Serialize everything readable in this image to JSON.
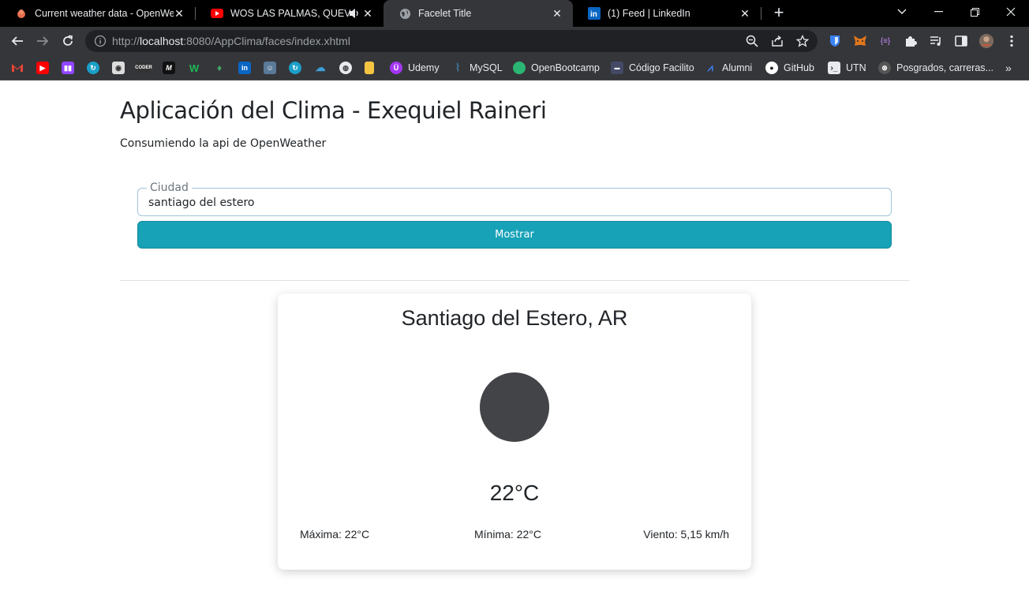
{
  "browser": {
    "tabs": [
      {
        "title": "Current weather data - OpenWea",
        "icon": "openweather-icon"
      },
      {
        "title": "WOS LAS PALMAS, QUEVEDO",
        "icon": "youtube-icon",
        "audio": true
      },
      {
        "title": "Facelet Title",
        "icon": "globe-icon",
        "active": true
      },
      {
        "title": "(1) Feed | LinkedIn",
        "icon": "linkedin-icon"
      }
    ],
    "url_scheme": "http://",
    "url_host": "localhost",
    "url_rest": ":8080/AppClima/faces/index.xhtml",
    "bookmarks": [
      {
        "label": "",
        "icon": "gmail-icon",
        "color": "#ea4335"
      },
      {
        "label": "",
        "icon": "youtube-icon",
        "color": "#ff0000"
      },
      {
        "label": "",
        "icon": "twitch-icon",
        "color": "#9146ff"
      },
      {
        "label": "",
        "icon": "refresh-circle-icon",
        "color": "#1a73e8"
      },
      {
        "label": "",
        "icon": "camera-icon",
        "color": "#888888"
      },
      {
        "label": "",
        "icon": "coder-icon",
        "color": "#444444"
      },
      {
        "label": "",
        "icon": "medium-icon",
        "color": "#111111"
      },
      {
        "label": "",
        "icon": "w-icon",
        "color": "#1db954"
      },
      {
        "label": "",
        "icon": "ethereum-icon",
        "color": "#3fa66b"
      },
      {
        "label": "",
        "icon": "linkedin-icon",
        "color": "#0a66c2"
      },
      {
        "label": "",
        "icon": "avatar-icon",
        "color": "#5a7a99"
      },
      {
        "label": "",
        "icon": "refresh-circle-icon",
        "color": "#1a73e8"
      },
      {
        "label": "",
        "icon": "cloud-icon",
        "color": "#3b9fd8"
      },
      {
        "label": "",
        "icon": "globe-icon",
        "color": "#cccccc"
      },
      {
        "label": "",
        "icon": "note-icon",
        "color": "#f5c542"
      },
      {
        "label": "Udemy",
        "icon": "udemy-icon",
        "color": "#a435f0"
      },
      {
        "label": "MySQL",
        "icon": "mysql-icon",
        "color": "#4479a1"
      },
      {
        "label": "OpenBootcamp",
        "icon": "openbootcamp-icon",
        "color": "#2bb673"
      },
      {
        "label": "Código Facilito",
        "icon": "codigofacilito-icon",
        "color": "#5c6bc0"
      },
      {
        "label": "Alumni",
        "icon": "alumni-icon",
        "color": "#3d7ff2"
      },
      {
        "label": "GitHub",
        "icon": "github-icon",
        "color": "#ffffff"
      },
      {
        "label": "UTN",
        "icon": "terminal-icon",
        "color": "#dddddd"
      },
      {
        "label": "Posgrados, carreras...",
        "icon": "posgrados-icon",
        "color": "#666666"
      }
    ]
  },
  "page": {
    "heading": "Aplicación del Clima - Exequiel Raineri",
    "subtitle": "Consumiendo la api de OpenWeather",
    "form": {
      "legend": "Ciudad",
      "city_value": "santiago del estero",
      "submit_label": "Mostrar",
      "accent": "#17a2b8"
    },
    "weather": {
      "city": "Santiago del Estero, AR",
      "icon": "weather-icon",
      "temperature": "22°C",
      "max": "Máxima: 22°C",
      "min": "Mínima: 22°C",
      "wind": "Viento: 5,15 km/h"
    }
  }
}
